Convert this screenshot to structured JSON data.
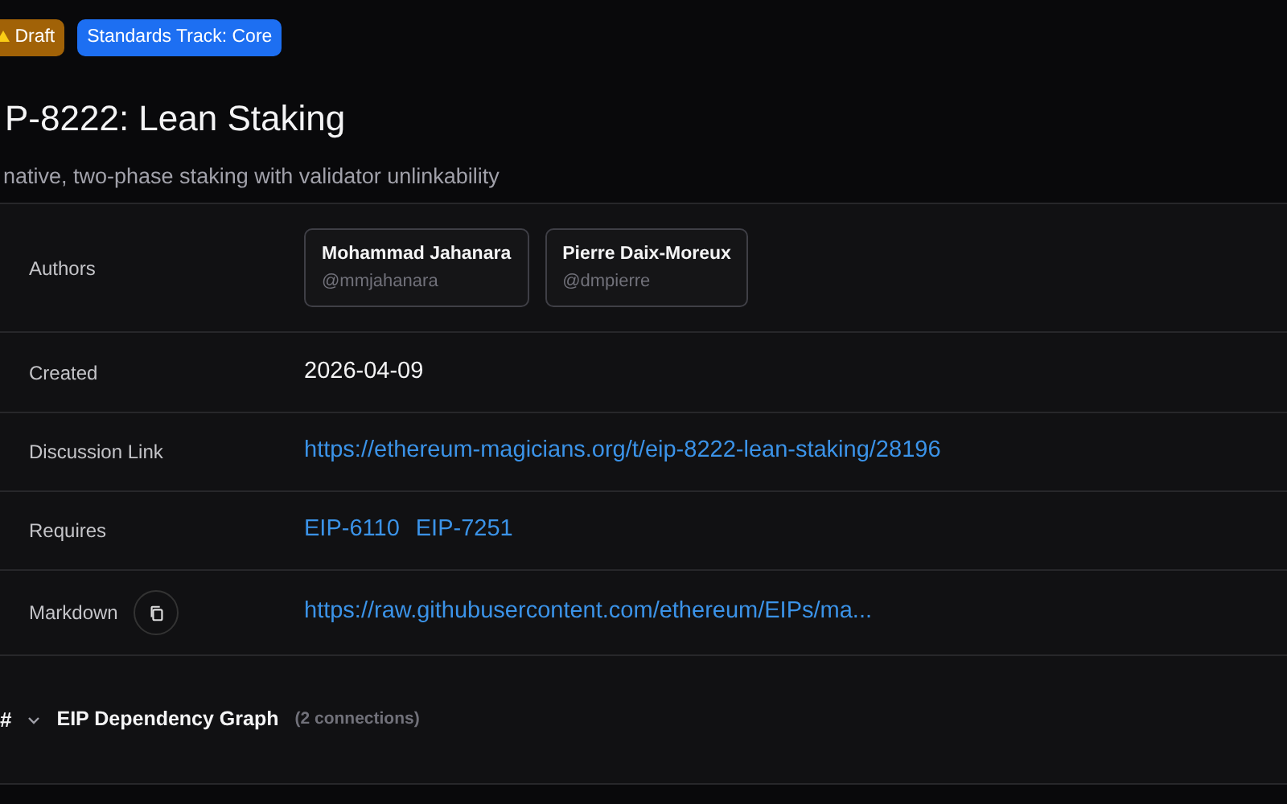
{
  "badges": [
    {
      "label": "Draft",
      "kind": "status"
    },
    {
      "label": "Standards Track: Core",
      "kind": "track"
    }
  ],
  "title": "P-8222: Lean Staking",
  "description": "native, two-phase staking with validator unlinkability",
  "metadata": [
    {
      "kind": "authors",
      "label": "Authors",
      "authors": [
        {
          "name": "Mohammad Jahanara",
          "handle": "@mmjahanara"
        },
        {
          "name": "Pierre Daix-Moreux",
          "handle": "@dmpierre"
        }
      ]
    },
    {
      "kind": "text",
      "label": "Created",
      "value": "2026-04-09"
    },
    {
      "kind": "links",
      "label": "Discussion Link",
      "links": [
        "https://ethereum-magicians.org/t/eip-8222-lean-staking/28196"
      ]
    },
    {
      "kind": "links",
      "label": "Requires",
      "links": [
        "EIP-6110",
        "EIP-7251"
      ]
    },
    {
      "kind": "copy",
      "label": "Markdown",
      "links": [
        "https://raw.githubusercontent.com/ethereum/EIPs/ma..."
      ]
    }
  ],
  "graph_section": {
    "anchor": "#",
    "title": "EIP Dependency Graph",
    "count": "(2 connections)"
  }
}
